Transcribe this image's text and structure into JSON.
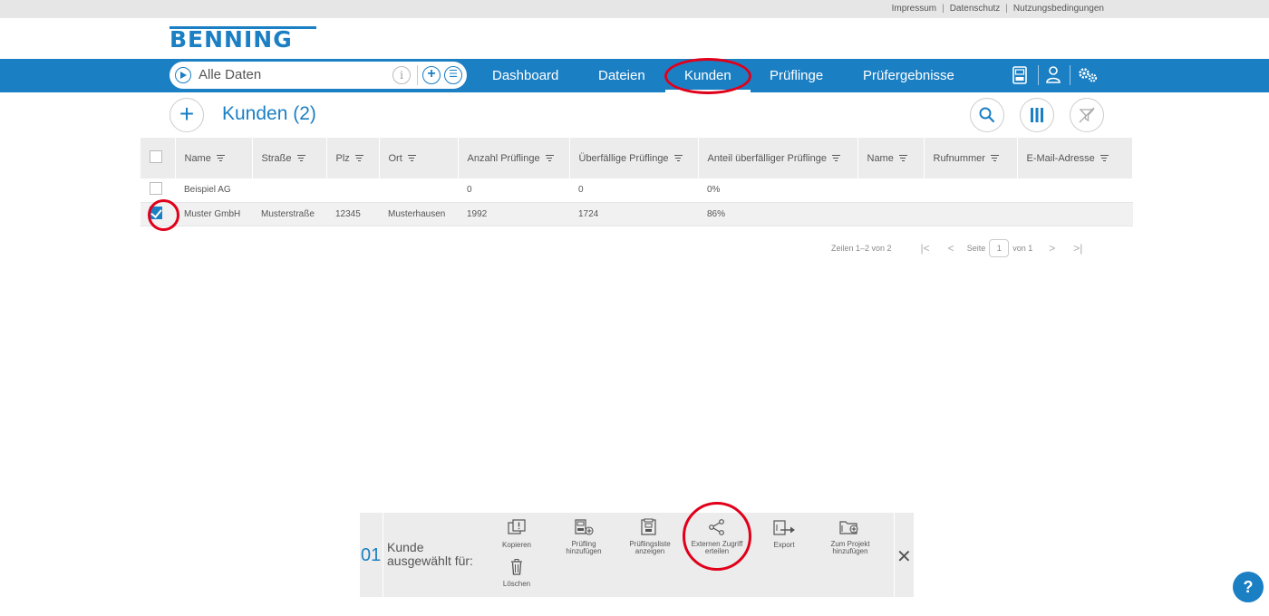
{
  "toplinks": [
    "Impressum",
    "Datenschutz",
    "Nutzungsbedingungen"
  ],
  "logo": "BENNING",
  "search": {
    "text": "Alle Daten"
  },
  "nav": {
    "items": [
      "Dashboard",
      "Dateien",
      "Kunden",
      "Prüflinge",
      "Prüfergebnisse"
    ],
    "active": "Kunden"
  },
  "page": {
    "title": "Kunden (2)"
  },
  "table": {
    "headers": [
      "Name",
      "Straße",
      "Plz",
      "Ort",
      "Anzahl Prüflinge",
      "Überfällige Prüflinge",
      "Anteil überfälliger Prüflinge",
      "Name",
      "Rufnummer",
      "E-Mail-Adresse"
    ],
    "rows": [
      {
        "selected": false,
        "cells": [
          "Beispiel AG",
          "",
          "",
          "",
          "0",
          "0",
          "0%",
          "",
          "",
          ""
        ]
      },
      {
        "selected": true,
        "cells": [
          "Muster GmbH",
          "Musterstraße",
          "12345",
          "Musterhausen",
          "1992",
          "1724",
          "86%",
          "",
          "",
          ""
        ]
      }
    ]
  },
  "pager": {
    "rows_label": "Zeilen 1–2 von 2",
    "page_label": "Seite",
    "page": "1",
    "of_label": "von 1"
  },
  "actionbar": {
    "count": "01",
    "text_line1": "Kunde",
    "text_line2": "ausgewählt für:",
    "actions": {
      "kopieren": "Kopieren",
      "loeschen": "Löschen",
      "pruefling_1": "Prüfling",
      "pruefling_2": "hinzufügen",
      "liste_1": "Prüflingsliste",
      "liste_2": "anzeigen",
      "extern_1": "Externen Zugriff",
      "extern_2": "erteilen",
      "export": "Export",
      "projekt_1": "Zum Projekt",
      "projekt_2": "hinzufügen"
    }
  },
  "help": "?",
  "colors": {
    "brand": "#1b7fc4",
    "highlight_ring": "#e0001a"
  }
}
